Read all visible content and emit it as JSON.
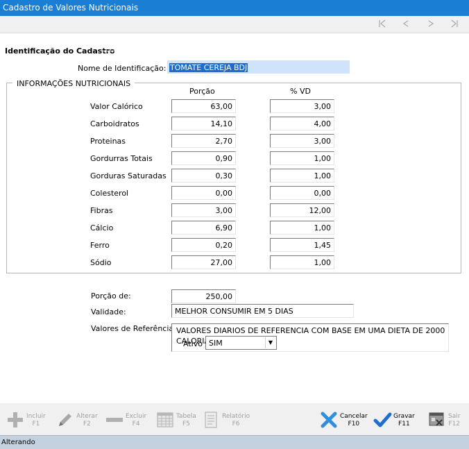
{
  "window": {
    "title": "Cadastro de Valores Nutricionais"
  },
  "nav": {
    "first_icon": "first-record-icon",
    "prev_icon": "prev-record-icon",
    "next_icon": "next-record-icon",
    "last_icon": "last-record-icon"
  },
  "identificacao": {
    "section_title": "Identificação do Cadastro",
    "nome_label": "Nome de Identificação:",
    "nome_value": "TOMATE CEREJA BDJ"
  },
  "info": {
    "group_title": "INFORMAÇÕES NUTRICIONAIS",
    "col_porcao": "Porção",
    "col_vd": "% VD",
    "rows": [
      {
        "label": "Valor Calórico",
        "porcao": "63,00",
        "vd": "3,00"
      },
      {
        "label": "Carboidratos",
        "porcao": "14,10",
        "vd": "4,00"
      },
      {
        "label": "Proteinas",
        "porcao": "2,70",
        "vd": "3,00"
      },
      {
        "label": "Gordurras Totais",
        "porcao": "0,90",
        "vd": "1,00"
      },
      {
        "label": "Gorduras Saturadas",
        "porcao": "0,30",
        "vd": "1,00"
      },
      {
        "label": "Colesterol",
        "porcao": "0,00",
        "vd": "0,00"
      },
      {
        "label": "Fibras",
        "porcao": "3,00",
        "vd": "12,00"
      },
      {
        "label": "Cálcio",
        "porcao": "6,90",
        "vd": "1,00"
      },
      {
        "label": "Ferro",
        "porcao": "0,20",
        "vd": "1,45"
      },
      {
        "label": "Sódio",
        "porcao": "27,00",
        "vd": "1,00"
      }
    ]
  },
  "extra": {
    "porcao_label": "Porção de:",
    "porcao_value": "250,00",
    "validade_label": "Validade:",
    "validade_value": "MELHOR CONSUMIR EM 5 DIAS",
    "referencia_label": "Valores de Referência",
    "referencia_value": "VALORES DIARIOS DE REFERENCIA COM BASE EM UMA DIETA DE 2000 CALORIAS."
  },
  "ativo": {
    "label": "Ativo",
    "value": "SIM"
  },
  "toolbar": {
    "incluir": {
      "label": "Incluir",
      "key": "F1"
    },
    "alterar": {
      "label": "Alterar",
      "key": "F2"
    },
    "excluir": {
      "label": "Excluir",
      "key": "F4"
    },
    "tabela": {
      "label": "Tabela",
      "key": "F5"
    },
    "relatorio": {
      "label": "Relatório",
      "key": "F6"
    },
    "cancelar": {
      "label": "Cancelar",
      "key": "F10"
    },
    "gravar": {
      "label": "Gravar",
      "key": "F11"
    },
    "sair": {
      "label": "Sair",
      "key": "F12"
    }
  },
  "status": {
    "text": "Alterando"
  },
  "colors": {
    "titlebar": "#1a7fd4",
    "selection": "#1f6ccf",
    "check": "#1e6fd0",
    "statusbar": "#c4d1de"
  }
}
